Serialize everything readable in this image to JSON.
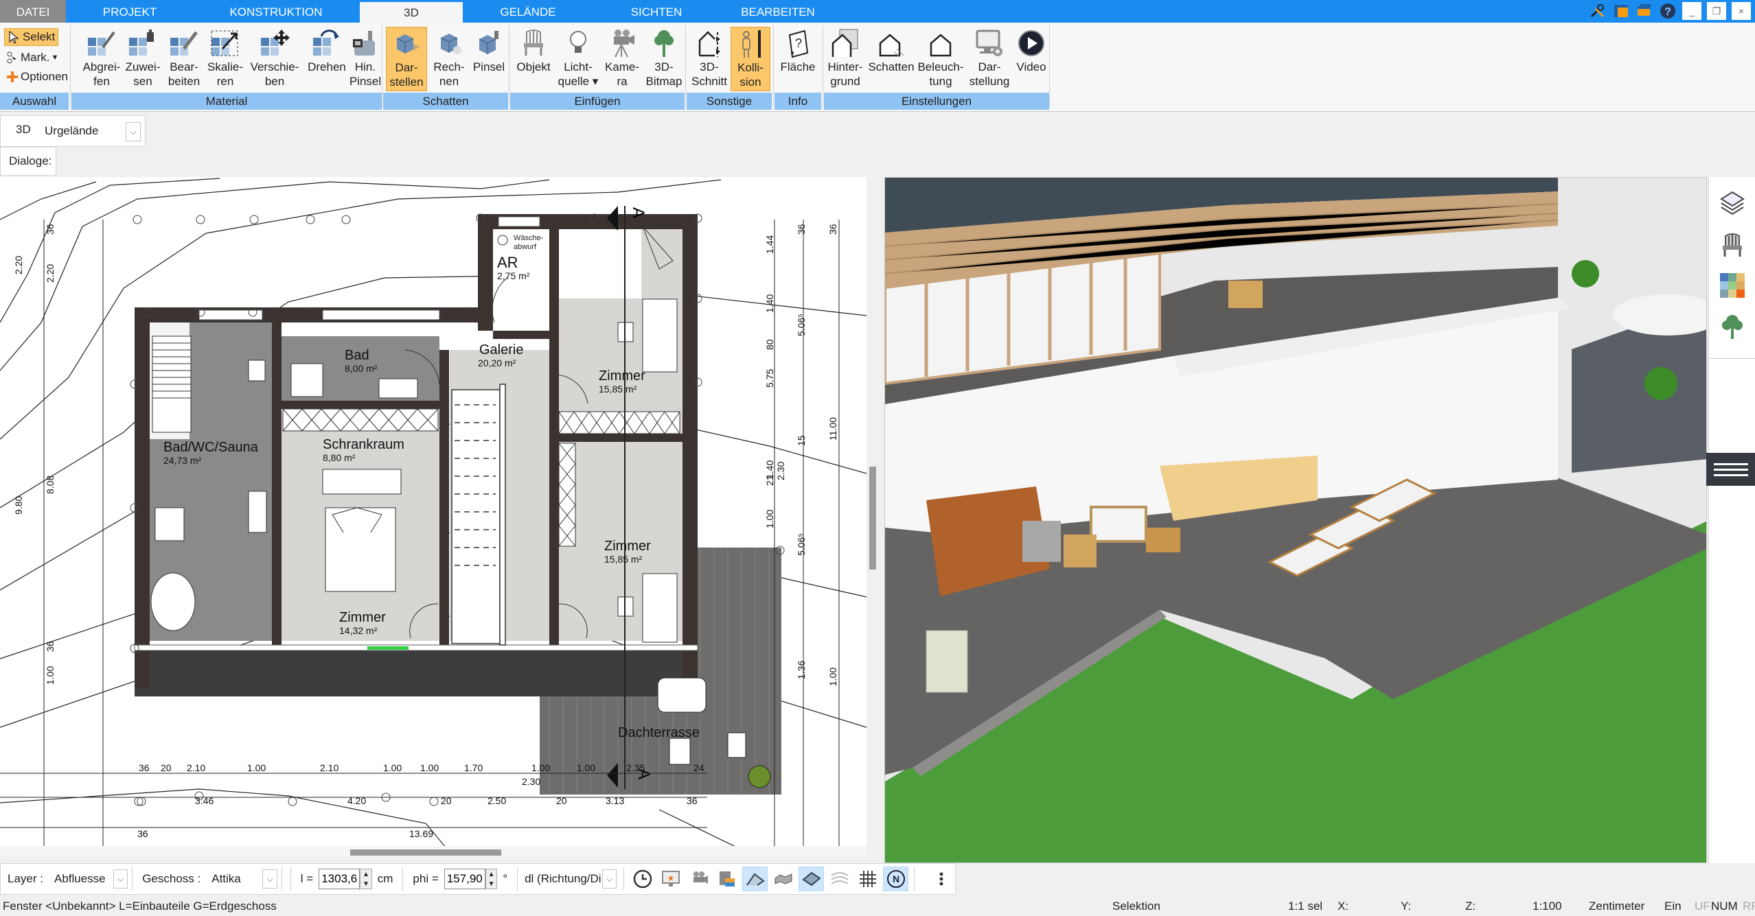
{
  "tabs": [
    {
      "label": "DATEI"
    },
    {
      "label": "PROJEKT"
    },
    {
      "label": "KONSTRUKTION"
    },
    {
      "label": "3D"
    },
    {
      "label": "GELÄNDE"
    },
    {
      "label": "SICHTEN"
    },
    {
      "label": "BEARBEITEN"
    }
  ],
  "window_controls": {
    "minimize": "_",
    "restore": "❐",
    "close": "×"
  },
  "ribbon": {
    "auswahl": {
      "label": "Auswahl",
      "selekt": "Selekt",
      "mark": "Mark.",
      "optionen": "Optionen"
    },
    "material": {
      "label": "Material",
      "buttons": [
        {
          "l1": "Abgrei-",
          "l2": "fen"
        },
        {
          "l1": "Zuwei-",
          "l2": "sen"
        },
        {
          "l1": "Bear-",
          "l2": "beiten"
        },
        {
          "l1": "Skalie-",
          "l2": "ren"
        },
        {
          "l1": "Verschie-",
          "l2": "ben"
        },
        {
          "l1": "Drehen",
          "l2": ""
        },
        {
          "l1": "Hin.",
          "l2": "Pinsel"
        }
      ]
    },
    "schatten": {
      "label": "Schatten",
      "buttons": [
        {
          "l1": "Dar-",
          "l2": "stellen"
        },
        {
          "l1": "Rech-",
          "l2": "nen"
        },
        {
          "l1": "Pinsel",
          "l2": ""
        }
      ]
    },
    "einfuegen": {
      "label": "Einfügen",
      "buttons": [
        {
          "l1": "Objekt",
          "l2": ""
        },
        {
          "l1": "Licht-",
          "l2": "quelle ▾"
        },
        {
          "l1": "Kame-",
          "l2": "ra"
        },
        {
          "l1": "3D-",
          "l2": "Bitmap"
        }
      ]
    },
    "sonstige": {
      "label": "Sonstige",
      "buttons": [
        {
          "l1": "3D-",
          "l2": "Schnitt"
        },
        {
          "l1": "Kolli-",
          "l2": "sion"
        }
      ]
    },
    "info": {
      "label": "Info",
      "buttons": [
        {
          "l1": "Fläche",
          "l2": ""
        }
      ]
    },
    "einstellungen": {
      "label": "Einstellungen",
      "buttons": [
        {
          "l1": "Hinter-",
          "l2": "grund"
        },
        {
          "l1": "Schatten",
          "l2": ""
        },
        {
          "l1": "Beleuch-",
          "l2": "tung"
        },
        {
          "l1": "Dar-",
          "l2": "stellung"
        },
        {
          "l1": "Video",
          "l2": ""
        }
      ]
    }
  },
  "view_bar": {
    "mode": "3D",
    "terrain": "Urgelände"
  },
  "dialog_bar": {
    "label": "Dialoge:"
  },
  "plan": {
    "rooms": [
      {
        "name": "Bad/WC/Sauna",
        "area": "24,73 m²"
      },
      {
        "name": "Bad",
        "area": "8,00 m²"
      },
      {
        "name": "Schrankraum",
        "area": "8,80 m²"
      },
      {
        "name": "Galerie",
        "area": "20,20 m²"
      },
      {
        "name": "AR",
        "area": "2,75 m²"
      },
      {
        "name": "Zimmer",
        "area": "15,85 m²"
      },
      {
        "name": "Zimmer",
        "area": "15,85 m²"
      },
      {
        "name": "Zimmer",
        "area": "14,32 m²"
      },
      {
        "name": "Dachterrasse",
        "area": ""
      }
    ],
    "laundry_chute": {
      "l1": "Wäsche-",
      "l2": "abwurf"
    },
    "section_marker": "A",
    "dims_bottom_row1": [
      "36",
      "20",
      "2.10",
      "1.00",
      "2.10",
      "1.00",
      "1.00",
      "1.70",
      "1.00",
      "1.00",
      "2.35",
      "24"
    ],
    "dims_bottom_extra": "2.30",
    "dims_bottom_row2": [
      "3.46",
      "4.20",
      "20",
      "2.50",
      "20",
      "3.13",
      "36"
    ],
    "dims_bottom_row3": [
      "36",
      "13.69"
    ],
    "dims_left_outer": [
      "2.20",
      "9.80"
    ],
    "dims_left_inner": [
      "36",
      "2.20",
      "8.08",
      "36",
      "1.00"
    ],
    "dims_right_1": [
      "1.44",
      "1.40",
      "80",
      "5.75",
      "1.40",
      "21",
      "1.00"
    ],
    "dims_right_1b": [
      "2.30"
    ],
    "dims_right_2": [
      "36",
      "5.06⁵",
      "15",
      "5.06⁵",
      "1.36"
    ],
    "dims_right_3": [
      "36",
      "11.00",
      "1.00"
    ]
  },
  "bottom_toolbar": {
    "layer_label": "Layer :",
    "layer_value": "Abfluesse",
    "geschoss_label": "Geschoss :",
    "geschoss_value": "Attika",
    "l_label": "l =",
    "l_value": "1303,6",
    "l_unit": "cm",
    "phi_label": "phi =",
    "phi_value": "157,90",
    "phi_unit": "°",
    "dl_value": "dl (Richtung/Di"
  },
  "status": {
    "left": "Fenster <Unbekannt> L=Einbauteile G=Erdgeschoss",
    "mode": "Selektion",
    "sel": "1:1 sel",
    "x": "X:",
    "y": "Y:",
    "z": "Z:",
    "scale": "1:100",
    "unit": "Zentimeter",
    "ein": "Ein",
    "uf": "UF",
    "num": "NUM",
    "rf": "RF"
  },
  "colors": {
    "accent": "#1a8cf0",
    "active_button": "#fbc76a",
    "group_label": "#8ec3f4",
    "wall": "#3a3330",
    "floor": "#d7d5d2",
    "tile": "#8d8d8d",
    "deck": "#6e6c6b",
    "lawn": "#4a9a3a"
  }
}
